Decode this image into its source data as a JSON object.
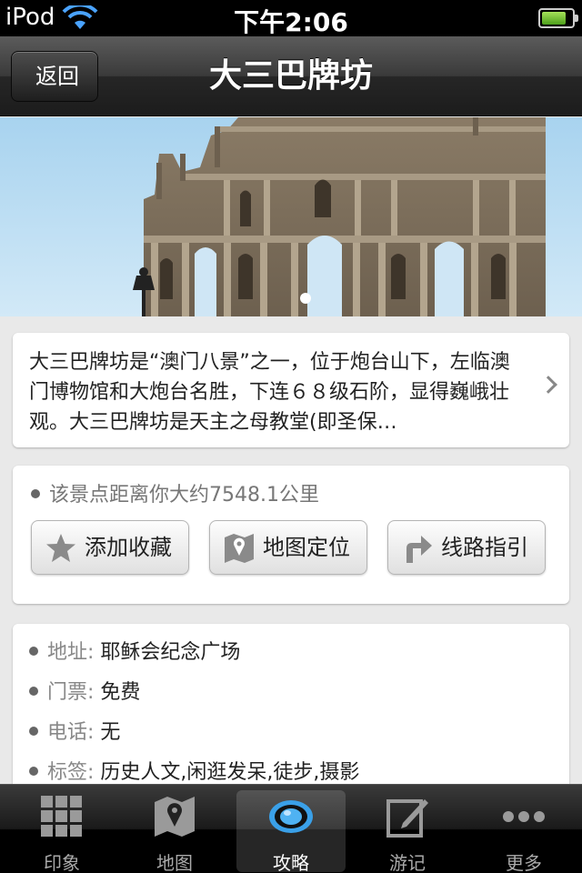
{
  "status_bar": {
    "carrier": "iPod",
    "time": "下午2:06",
    "battery_level": 0.8
  },
  "nav": {
    "back_label": "返回",
    "title": "大三巴牌坊"
  },
  "hero": {
    "page_count": 1,
    "current_page": 1
  },
  "description": {
    "text": "大三巴牌坊是“澳门八景”之一，位于炮台山下，左临澳门博物馆和大炮台名胜，下连６８级石阶，显得巍峨壮观。大三巴牌坊是天主之母教堂(即圣保…"
  },
  "actions": {
    "distance": "该景点距离你大约7548.1公里",
    "favorite_label": "添加收藏",
    "map_label": "地图定位",
    "route_label": "线路指引"
  },
  "info": {
    "address_key": "地址:",
    "address_val": "耶稣会纪念广场",
    "ticket_key": "门票:",
    "ticket_val": "免费",
    "phone_key": "电话:",
    "phone_val": "无",
    "tags_key": "标签:",
    "tags_val": "历史人文,闲逛发呆,徒步,摄影"
  },
  "tabbar": {
    "items": [
      {
        "label": "印象",
        "icon": "grid-icon"
      },
      {
        "label": "地图",
        "icon": "map-icon"
      },
      {
        "label": "攻略",
        "icon": "eye-icon",
        "active": true
      },
      {
        "label": "游记",
        "icon": "edit-icon"
      },
      {
        "label": "更多",
        "icon": "more-icon"
      }
    ]
  },
  "colors": {
    "background": "#e9e9e9",
    "nav_bar": "#2a2a2a",
    "tab_active": "#3aa0e8"
  }
}
